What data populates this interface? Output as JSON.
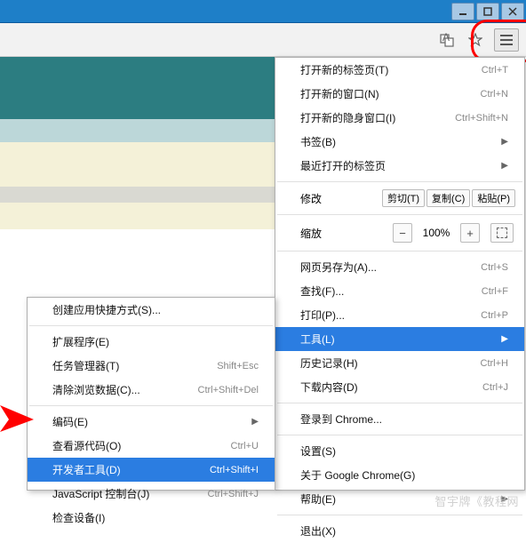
{
  "window_buttons": {
    "minimize": "_",
    "maximize": "□",
    "close": "X"
  },
  "menu1": {
    "new_tab": {
      "label": "打开新的标签页(T)",
      "shortcut": "Ctrl+T"
    },
    "new_window": {
      "label": "打开新的窗口(N)",
      "shortcut": "Ctrl+N"
    },
    "incognito": {
      "label": "打开新的隐身窗口(I)",
      "shortcut": "Ctrl+Shift+N"
    },
    "bookmarks": {
      "label": "书签(B)"
    },
    "recent_tabs": {
      "label": "最近打开的标签页"
    },
    "edit": {
      "label": "修改",
      "cut": "剪切(T)",
      "copy": "复制(C)",
      "paste": "粘贴(P)"
    },
    "zoom": {
      "label": "缩放",
      "value": "100%"
    },
    "save_as": {
      "label": "网页另存为(A)...",
      "shortcut": "Ctrl+S"
    },
    "find": {
      "label": "查找(F)...",
      "shortcut": "Ctrl+F"
    },
    "print": {
      "label": "打印(P)...",
      "shortcut": "Ctrl+P"
    },
    "tools": {
      "label": "工具(L)"
    },
    "history": {
      "label": "历史记录(H)",
      "shortcut": "Ctrl+H"
    },
    "downloads": {
      "label": "下载内容(D)",
      "shortcut": "Ctrl+J"
    },
    "signin": {
      "label": "登录到 Chrome..."
    },
    "settings": {
      "label": "设置(S)"
    },
    "about": {
      "label": "关于 Google Chrome(G)"
    },
    "help": {
      "label": "帮助(E)"
    },
    "exit": {
      "label": "退出(X)"
    }
  },
  "menu2": {
    "create_shortcut": {
      "label": "创建应用快捷方式(S)..."
    },
    "extensions": {
      "label": "扩展程序(E)"
    },
    "task_manager": {
      "label": "任务管理器(T)",
      "shortcut": "Shift+Esc"
    },
    "clear_data": {
      "label": "清除浏览数据(C)...",
      "shortcut": "Ctrl+Shift+Del"
    },
    "encoding": {
      "label": "编码(E)"
    },
    "view_source": {
      "label": "查看源代码(O)",
      "shortcut": "Ctrl+U"
    },
    "dev_tools": {
      "label": "开发者工具(D)",
      "shortcut": "Ctrl+Shift+I"
    },
    "js_console": {
      "label": "JavaScript 控制台(J)",
      "shortcut": "Ctrl+Shift+J"
    },
    "inspect": {
      "label": "检查设备(I)"
    }
  },
  "watermark": "智宇牌《教程网"
}
